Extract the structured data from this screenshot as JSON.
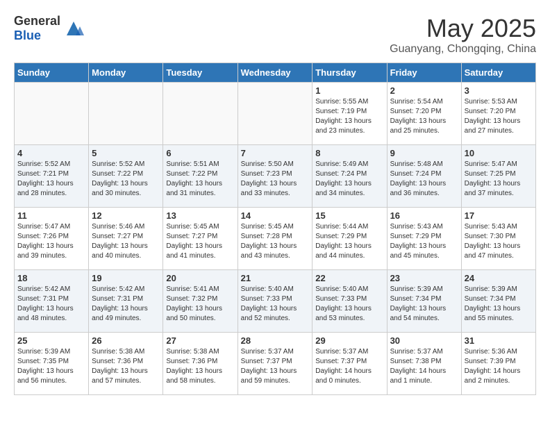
{
  "header": {
    "logo_general": "General",
    "logo_blue": "Blue",
    "month_title": "May 2025",
    "location": "Guanyang, Chongqing, China"
  },
  "days_of_week": [
    "Sunday",
    "Monday",
    "Tuesday",
    "Wednesday",
    "Thursday",
    "Friday",
    "Saturday"
  ],
  "weeks": [
    [
      {
        "day": "",
        "info": ""
      },
      {
        "day": "",
        "info": ""
      },
      {
        "day": "",
        "info": ""
      },
      {
        "day": "",
        "info": ""
      },
      {
        "day": "1",
        "info": "Sunrise: 5:55 AM\nSunset: 7:19 PM\nDaylight: 13 hours\nand 23 minutes."
      },
      {
        "day": "2",
        "info": "Sunrise: 5:54 AM\nSunset: 7:20 PM\nDaylight: 13 hours\nand 25 minutes."
      },
      {
        "day": "3",
        "info": "Sunrise: 5:53 AM\nSunset: 7:20 PM\nDaylight: 13 hours\nand 27 minutes."
      }
    ],
    [
      {
        "day": "4",
        "info": "Sunrise: 5:52 AM\nSunset: 7:21 PM\nDaylight: 13 hours\nand 28 minutes."
      },
      {
        "day": "5",
        "info": "Sunrise: 5:52 AM\nSunset: 7:22 PM\nDaylight: 13 hours\nand 30 minutes."
      },
      {
        "day": "6",
        "info": "Sunrise: 5:51 AM\nSunset: 7:22 PM\nDaylight: 13 hours\nand 31 minutes."
      },
      {
        "day": "7",
        "info": "Sunrise: 5:50 AM\nSunset: 7:23 PM\nDaylight: 13 hours\nand 33 minutes."
      },
      {
        "day": "8",
        "info": "Sunrise: 5:49 AM\nSunset: 7:24 PM\nDaylight: 13 hours\nand 34 minutes."
      },
      {
        "day": "9",
        "info": "Sunrise: 5:48 AM\nSunset: 7:24 PM\nDaylight: 13 hours\nand 36 minutes."
      },
      {
        "day": "10",
        "info": "Sunrise: 5:47 AM\nSunset: 7:25 PM\nDaylight: 13 hours\nand 37 minutes."
      }
    ],
    [
      {
        "day": "11",
        "info": "Sunrise: 5:47 AM\nSunset: 7:26 PM\nDaylight: 13 hours\nand 39 minutes."
      },
      {
        "day": "12",
        "info": "Sunrise: 5:46 AM\nSunset: 7:27 PM\nDaylight: 13 hours\nand 40 minutes."
      },
      {
        "day": "13",
        "info": "Sunrise: 5:45 AM\nSunset: 7:27 PM\nDaylight: 13 hours\nand 41 minutes."
      },
      {
        "day": "14",
        "info": "Sunrise: 5:45 AM\nSunset: 7:28 PM\nDaylight: 13 hours\nand 43 minutes."
      },
      {
        "day": "15",
        "info": "Sunrise: 5:44 AM\nSunset: 7:29 PM\nDaylight: 13 hours\nand 44 minutes."
      },
      {
        "day": "16",
        "info": "Sunrise: 5:43 AM\nSunset: 7:29 PM\nDaylight: 13 hours\nand 45 minutes."
      },
      {
        "day": "17",
        "info": "Sunrise: 5:43 AM\nSunset: 7:30 PM\nDaylight: 13 hours\nand 47 minutes."
      }
    ],
    [
      {
        "day": "18",
        "info": "Sunrise: 5:42 AM\nSunset: 7:31 PM\nDaylight: 13 hours\nand 48 minutes."
      },
      {
        "day": "19",
        "info": "Sunrise: 5:42 AM\nSunset: 7:31 PM\nDaylight: 13 hours\nand 49 minutes."
      },
      {
        "day": "20",
        "info": "Sunrise: 5:41 AM\nSunset: 7:32 PM\nDaylight: 13 hours\nand 50 minutes."
      },
      {
        "day": "21",
        "info": "Sunrise: 5:40 AM\nSunset: 7:33 PM\nDaylight: 13 hours\nand 52 minutes."
      },
      {
        "day": "22",
        "info": "Sunrise: 5:40 AM\nSunset: 7:33 PM\nDaylight: 13 hours\nand 53 minutes."
      },
      {
        "day": "23",
        "info": "Sunrise: 5:39 AM\nSunset: 7:34 PM\nDaylight: 13 hours\nand 54 minutes."
      },
      {
        "day": "24",
        "info": "Sunrise: 5:39 AM\nSunset: 7:34 PM\nDaylight: 13 hours\nand 55 minutes."
      }
    ],
    [
      {
        "day": "25",
        "info": "Sunrise: 5:39 AM\nSunset: 7:35 PM\nDaylight: 13 hours\nand 56 minutes."
      },
      {
        "day": "26",
        "info": "Sunrise: 5:38 AM\nSunset: 7:36 PM\nDaylight: 13 hours\nand 57 minutes."
      },
      {
        "day": "27",
        "info": "Sunrise: 5:38 AM\nSunset: 7:36 PM\nDaylight: 13 hours\nand 58 minutes."
      },
      {
        "day": "28",
        "info": "Sunrise: 5:37 AM\nSunset: 7:37 PM\nDaylight: 13 hours\nand 59 minutes."
      },
      {
        "day": "29",
        "info": "Sunrise: 5:37 AM\nSunset: 7:37 PM\nDaylight: 14 hours\nand 0 minutes."
      },
      {
        "day": "30",
        "info": "Sunrise: 5:37 AM\nSunset: 7:38 PM\nDaylight: 14 hours\nand 1 minute."
      },
      {
        "day": "31",
        "info": "Sunrise: 5:36 AM\nSunset: 7:39 PM\nDaylight: 14 hours\nand 2 minutes."
      }
    ]
  ]
}
